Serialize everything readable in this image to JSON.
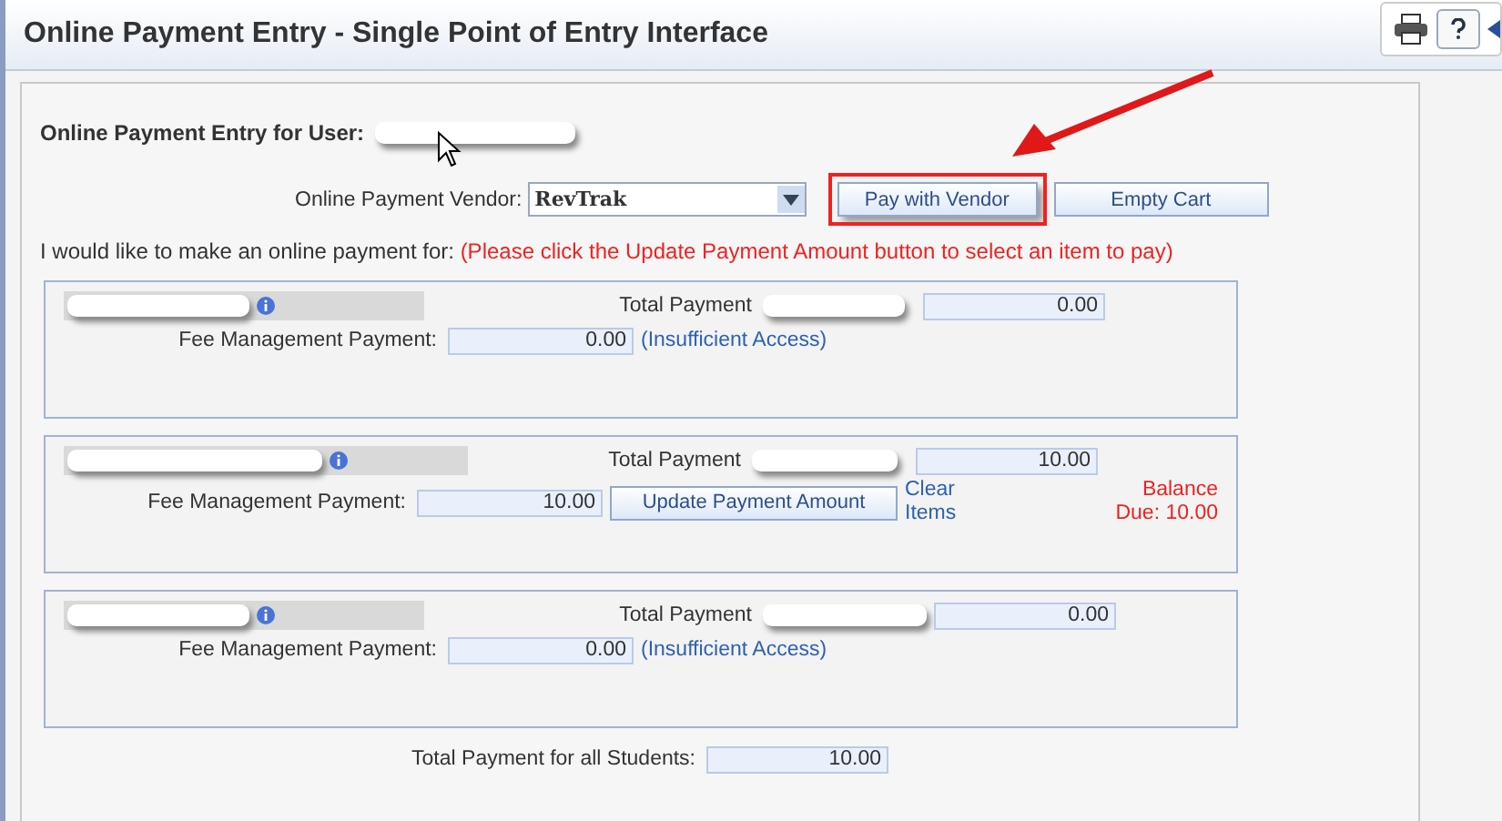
{
  "header": {
    "title": "Online Payment Entry - Single Point of Entry Interface"
  },
  "user_label": "Online Payment Entry for User:",
  "vendor": {
    "label": "Online Payment Vendor:",
    "value": "RevTrak"
  },
  "buttons": [
    {
      "label": "Pay with Vendor",
      "highlighted": true
    },
    {
      "label": "Empty Cart",
      "highlighted": false
    }
  ],
  "intro": {
    "text": "I would like to make an online payment for:",
    "note": "(Please click the Update Payment Amount button to select an item to pay)"
  },
  "students": [
    {
      "kind": "locked",
      "total_label": "Total Payment",
      "total": "0.00",
      "fee_label": "Fee Management Payment:",
      "fee": "0.00",
      "access_note": "(Insufficient Access)"
    },
    {
      "kind": "editable",
      "total_label": "Total Payment",
      "total": "10.00",
      "fee_label": "Fee Management Payment:",
      "fee": "10.00",
      "update_button": "Update Payment Amount",
      "clear_link": "Clear Items",
      "balance": "Balance Due: 10.00"
    },
    {
      "kind": "locked",
      "total_label": "Total Payment",
      "total": "0.00",
      "fee_label": "Fee Management Payment:",
      "fee": "0.00",
      "access_note": "(Insufficient Access)"
    }
  ],
  "grand_total": {
    "label": "Total Payment for all Students:",
    "value": "10.00"
  }
}
